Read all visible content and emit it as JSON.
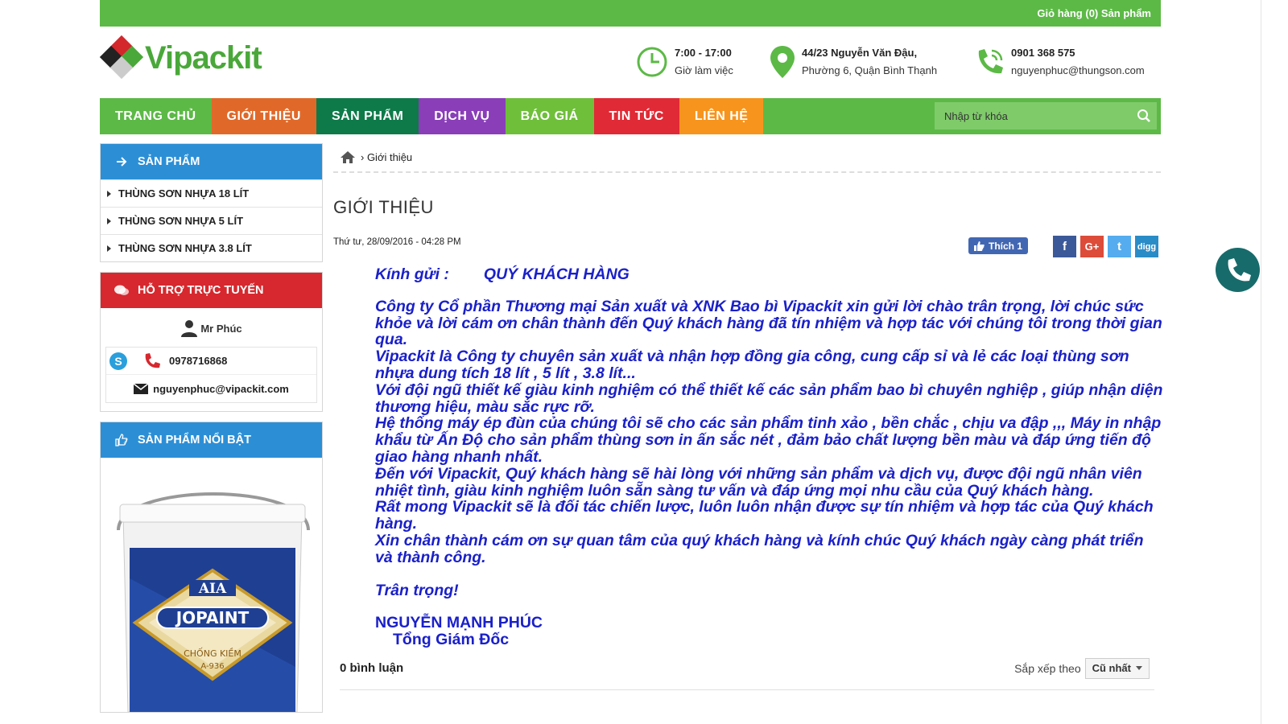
{
  "topbar": {
    "cart": "Giỏ hàng (0) Sản phẩm"
  },
  "logo": {
    "text_main": "Vipack",
    "text_accent": "it"
  },
  "header": {
    "hours": {
      "time": "7:00 - 17:00",
      "label": "Giờ làm việc"
    },
    "address": {
      "line1": "44/23 Nguyễn Văn Đậu,",
      "line2": "Phường 6, Quận Bình Thạnh"
    },
    "contact": {
      "phone": "0901 368 575",
      "email": "nguyenphuc@thungson.com"
    }
  },
  "nav": {
    "items": [
      {
        "label": "TRANG CHỦ",
        "color": "#5cb946"
      },
      {
        "label": "GIỚI THIỆU",
        "color": "#e0692a"
      },
      {
        "label": "SẢN PHẨM",
        "color": "#0e7a49"
      },
      {
        "label": "DỊCH VỤ",
        "color": "#8a3eb8"
      },
      {
        "label": "BÁO GIÁ",
        "color": "#6fbf3b"
      },
      {
        "label": "TIN TỨC",
        "color": "#e02a36"
      },
      {
        "label": "LIÊN HỆ",
        "color": "#f7941d"
      }
    ],
    "search_placeholder": "Nhập từ khóa"
  },
  "sidebar": {
    "products": {
      "title": "SẢN PHẨM",
      "items": [
        "THÙNG SƠN NHỰA 18 LÍT",
        "THÙNG SƠN NHỰA 5 LÍT",
        "THÙNG SƠN NHỰA 3.8 LÍT"
      ]
    },
    "support": {
      "title": "HỖ TRỢ TRỰC TUYẾN",
      "name": "Mr Phúc",
      "phone": "0978716868",
      "email": "nguyenphuc@vipackit.com"
    },
    "featured": {
      "title": "SẢN PHẨM NỔI BẬT",
      "product": {
        "brand": "AIA",
        "name": "JOPAINT",
        "tag1": "CHỐNG KIỀM",
        "tag2": "A-936"
      }
    }
  },
  "main": {
    "breadcrumb": "› Giới thiệu",
    "title": "GIỚI THIỆU",
    "date": "Thứ tư, 28/09/2016 - 04:28 PM",
    "like": "Thích 1",
    "shares": [
      "f",
      "G+",
      "t",
      "digg"
    ],
    "letter": {
      "greeting_label": "Kính gửi :",
      "greeting_to": "QUÝ KHÁCH HÀNG",
      "paragraphs": [
        "Công ty Cổ phần Thương mại Sản xuất và XNK Bao bì Vipackit xin gửi lời chào trân trọng, lời chúc sức khỏe và lời cám ơn chân thành đến Quý khách hàng đã tín nhiệm và hợp tác với chúng tôi trong thời gian qua.",
        "Vipackit là Công ty chuyên sản xuất và nhận hợp đồng gia công, cung cấp sỉ và lẻ các loại thùng sơn nhựa dung tích 18 lít , 5 lít , 3.8 lít...",
        "Với đội ngũ thiết kế giàu kinh nghiệm có thể thiết kế các sản phẩm bao bì chuyên nghiệp , giúp nhận diện thương hiệu, màu sắc rực rỡ.",
        "Hệ thống máy ép đùn của chúng tôi sẽ cho các sản phẩm tinh xảo , bền chắc , chịu va đập ,,, Máy in nhập khẩu từ Ấn Độ cho sản phẩm thùng sơn in ấn sắc nét , đảm bảo chất lượng bền màu và đáp ứng tiến độ giao hàng nhanh nhất.",
        "Đến với Vipackit, Quý khách hàng sẽ hài lòng với những sản phẩm và dịch vụ, được đội ngũ nhân viên nhiệt tình, giàu kinh nghiệm luôn sẵn sàng tư vấn và đáp ứng mọi nhu cầu của Quý khách hàng.",
        "Rất mong Vipackit sẽ là đối tác chiến lược, luôn luôn nhận được sự tín nhiệm và hợp tác của Quý khách hàng.",
        "Xin chân thành cám ơn sự quan tâm của quý khách hàng và kính chúc Quý khách  ngày càng phát triển và  thành công."
      ],
      "regards": "Trân trọng!",
      "signer": "NGUYỄN MẠNH PHÚC",
      "position": "Tổng Giám Đốc"
    },
    "comments": {
      "count": "0 bình luận",
      "sort_label": "Sắp xếp theo",
      "sort_value": "Cũ nhất"
    }
  }
}
